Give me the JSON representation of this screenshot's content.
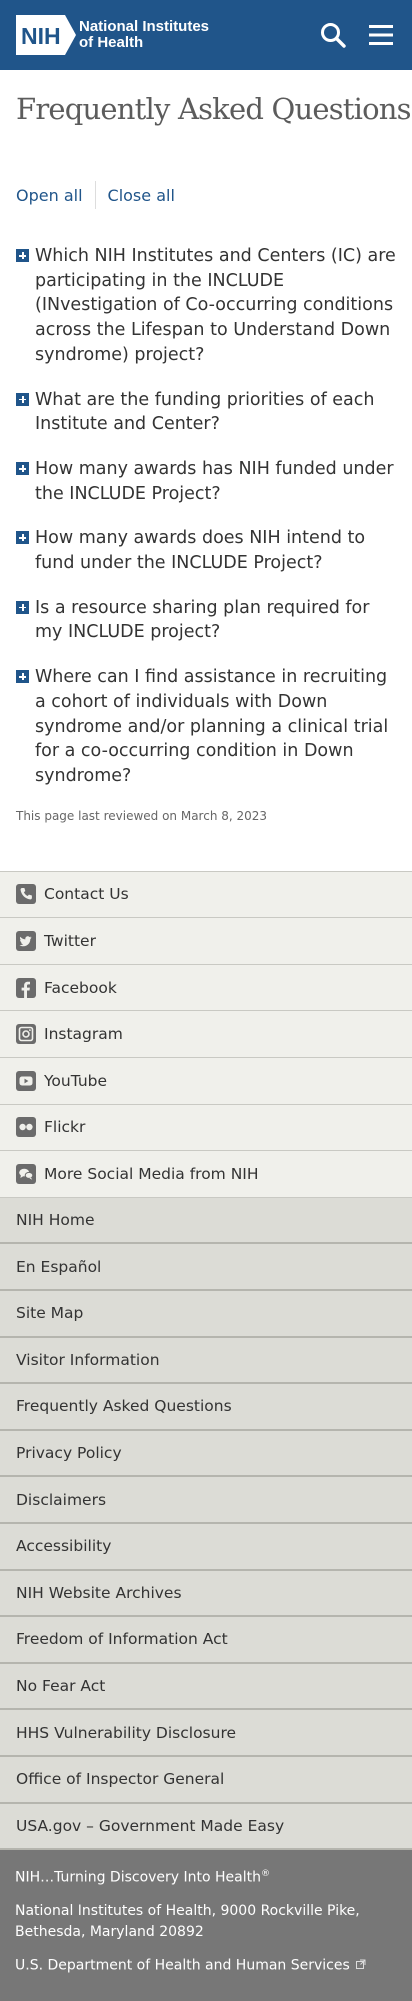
{
  "header": {
    "logo_abbr": "NIH",
    "logo_line1": "National Institutes",
    "logo_line2": "of Health",
    "brand_color": "#20558a"
  },
  "main": {
    "title": "Frequently Asked Questions",
    "open_all": "Open all",
    "close_all": "Close all",
    "faqs": [
      "Which NIH Institutes and Centers (IC) are participating in the INCLUDE (INvestigation of Co-occurring conditions across the Lifespan to Understand Down syndrome) project?",
      "What are the funding priorities of each Institute and Center?",
      "How many awards has NIH funded under the INCLUDE Project?",
      "How many awards does NIH intend to fund under the INCLUDE Project?",
      "Is a resource sharing plan required for my INCLUDE project?",
      "Where can I find assistance in recruiting a cohort of individuals with Down syndrome and/or planning a clinical trial for a co-occurring condition in Down syndrome?"
    ],
    "reviewed": "This page last reviewed on March 8, 2023"
  },
  "social": [
    {
      "label": "Contact Us",
      "icon": "phone-icon"
    },
    {
      "label": "Twitter",
      "icon": "twitter-icon"
    },
    {
      "label": "Facebook",
      "icon": "facebook-icon"
    },
    {
      "label": "Instagram",
      "icon": "instagram-icon"
    },
    {
      "label": "YouTube",
      "icon": "youtube-icon"
    },
    {
      "label": "Flickr",
      "icon": "flickr-icon"
    },
    {
      "label": "More Social Media from NIH",
      "icon": "chat-bubbles-icon"
    }
  ],
  "links": [
    "NIH Home",
    "En Español",
    "Site Map",
    "Visitor Information",
    "Frequently Asked Questions",
    "Privacy Policy",
    "Disclaimers",
    "Accessibility",
    "NIH Website Archives",
    "Freedom of Information Act",
    "No Fear Act",
    "HHS Vulnerability Disclosure",
    "Office of Inspector General",
    "USA.gov – Government Made Easy"
  ],
  "footer": {
    "tagline": "NIH…Turning Discovery Into Health",
    "tagline_mark": "®",
    "address_line1": "National Institutes of Health, 9000 Rockville Pike,",
    "address_line2": "Bethesda, Maryland 20892",
    "hhs_link": "U.S. Department of Health and Human Services"
  }
}
